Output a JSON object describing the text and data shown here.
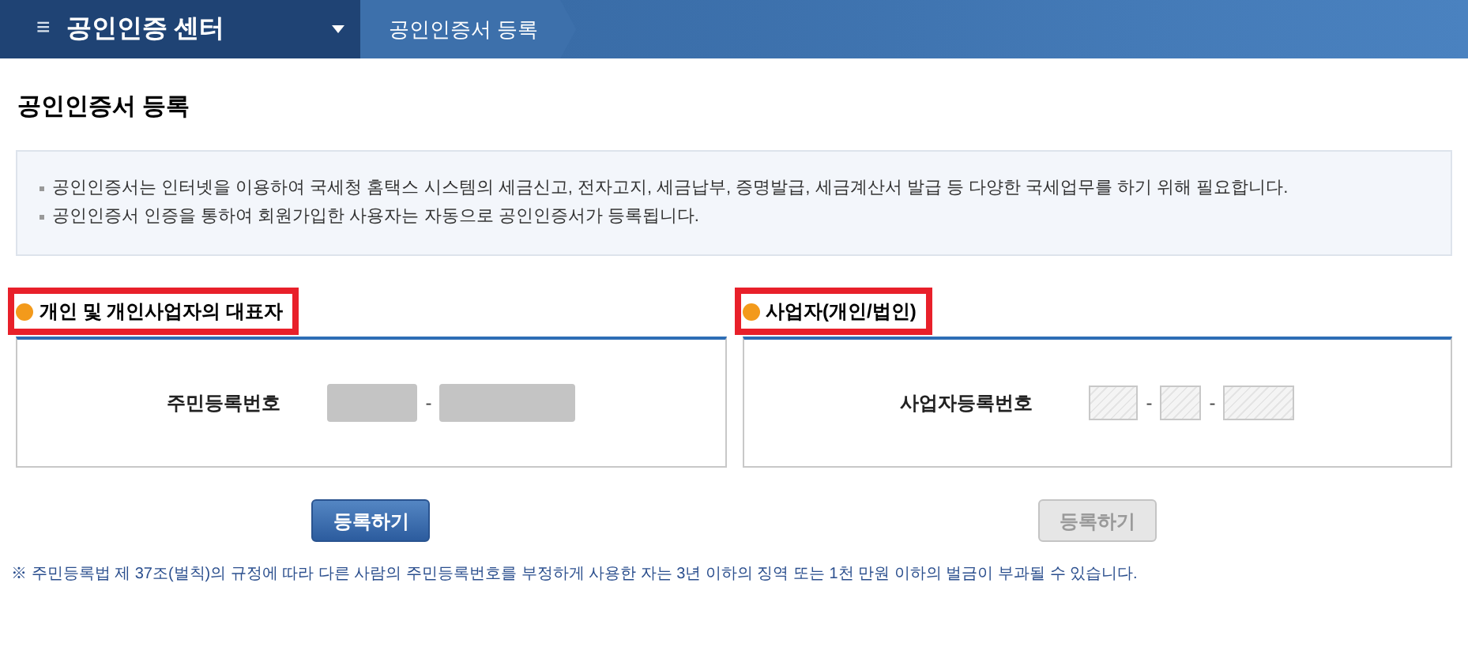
{
  "header": {
    "menu_icon": "≡",
    "title": "공인인증 센터",
    "breadcrumb": "공인인증서 등록"
  },
  "page_title": "공인인증서 등록",
  "notice": [
    "공인인증서는 인터넷을 이용하여 국세청 홈택스 시스템의 세금신고, 전자고지, 세금납부, 증명발급, 세금계산서 발급 등 다양한 국세업무를 하기 위해 필요합니다.",
    "공인인증서 인증을 통하여 회원가입한 사용자는 자동으로 공인인증서가 등록됩니다."
  ],
  "sections": [
    {
      "title": "개인 및 개인사업자의 대표자",
      "highlighted": true,
      "field_label": "주민등록번호",
      "separator": "-",
      "inputs": [
        {
          "kind": "masked"
        },
        {
          "kind": "masked"
        }
      ],
      "button": {
        "label": "등록하기",
        "disabled": false
      }
    },
    {
      "title": "사업자(개인/법인)",
      "highlighted": true,
      "field_label": "사업자등록번호",
      "separator": "-",
      "inputs": [
        {
          "kind": "hatched"
        },
        {
          "kind": "hatched"
        },
        {
          "kind": "hatched"
        }
      ],
      "button": {
        "label": "등록하기",
        "disabled": true
      }
    }
  ],
  "footnote": "※ 주민등록법 제 37조(벌칙)의 규정에 따라 다른 사람의 주민등록번호를 부정하게 사용한 자는 3년 이하의 징역 또는 1천 만원 이하의 벌금이 부과될 수 있습니다."
}
